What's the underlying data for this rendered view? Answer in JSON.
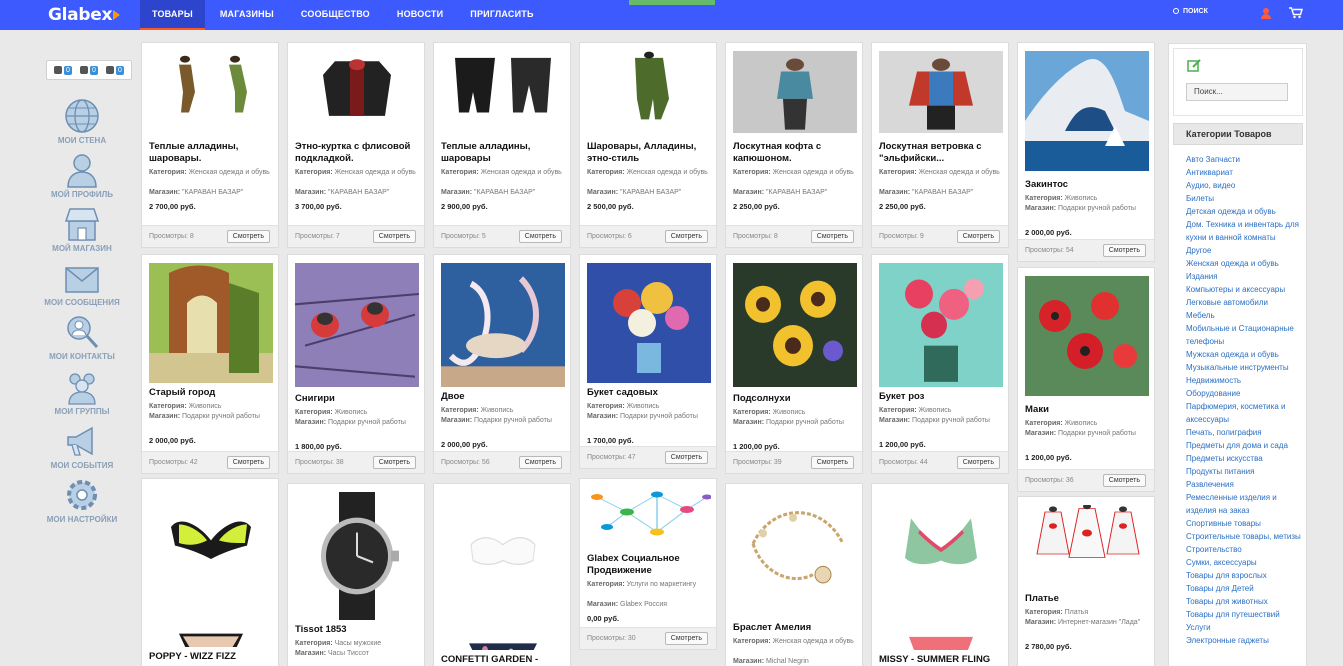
{
  "header": {
    "logo": "Glabex",
    "nav": [
      "ТОВАРЫ",
      "МАГАЗИНЫ",
      "СООБЩЕСТВО",
      "НОВОСТИ",
      "ПРИГЛАСИТЬ"
    ],
    "active_index": 0,
    "search": "ПОИСК"
  },
  "counters": [
    "0",
    "0",
    "0"
  ],
  "sidebar": [
    {
      "label": "МОИ СТЕНА",
      "icon": "globe-icon"
    },
    {
      "label": "МОЙ ПРОФИЛЬ",
      "icon": "profile-icon"
    },
    {
      "label": "МОЙ МАГАЗИН",
      "icon": "store-icon"
    },
    {
      "label": "МОИ СООБЩЕНИЯ",
      "icon": "envelope-icon"
    },
    {
      "label": "МОИ КОНТАКТЫ",
      "icon": "contacts-icon"
    },
    {
      "label": "МОИ ГРУППЫ",
      "icon": "groups-icon"
    },
    {
      "label": "МОИ СОБЫТИЯ",
      "icon": "megaphone-icon"
    },
    {
      "label": "МОИ НАСТРОЙКИ",
      "icon": "settings-icon"
    }
  ],
  "cards": [
    {
      "title": "Теплые алладины, шаровары.",
      "category": "Женская одежда и обувь",
      "shop": "\"КАРАВАН БАЗАР\"",
      "price": "2 700,00 руб.",
      "views": "8"
    },
    {
      "title": "Этно-куртка с флисовой подкладкой.",
      "category": "Женская одежда и обувь",
      "shop": "\"КАРАВАН БАЗАР\"",
      "price": "3 700,00 руб.",
      "views": "7"
    },
    {
      "title": "Теплые алладины, шаровары",
      "category": "Женская одежда и обувь",
      "shop": "\"КАРАВАН БАЗАР\"",
      "price": "2 900,00 руб.",
      "views": "5"
    },
    {
      "title": "Шаровары, Алладины, этно-стиль",
      "category": "Женская одежда и обувь",
      "shop": "\"КАРАВАН БАЗАР\"",
      "price": "2 500,00 руб.",
      "views": "6"
    },
    {
      "title": "Лоскутная кофта с капюшоном.",
      "category": "Женская одежда и обувь",
      "shop": "\"КАРАВАН БАЗАР\"",
      "price": "2 250,00 руб.",
      "views": "8"
    },
    {
      "title": "Лоскутная ветровка с \"эльфийски...",
      "category": "Женская одежда и обувь",
      "shop": "\"КАРАВАН БАЗАР\"",
      "price": "2 250,00 руб.",
      "views": "9"
    },
    {
      "title": "Закинтос",
      "category": "Живопись",
      "shop": "Подарки ручной работы",
      "price": "2 000,00 руб.",
      "views": "54"
    },
    {
      "title": "Старый город",
      "category": "Живопись",
      "shop": "Подарки ручной работы",
      "price": "2 000,00 руб.",
      "views": "42"
    },
    {
      "title": "Снигири",
      "category": "Живопись",
      "shop": "Подарки ручной работы",
      "price": "1 800,00 руб.",
      "views": "38"
    },
    {
      "title": "Двое",
      "category": "Живопись",
      "shop": "Подарки ручной работы",
      "price": "2 000,00 руб.",
      "views": "56"
    },
    {
      "title": "Букет садовых",
      "category": "Живопись",
      "shop": "Подарки ручной работы",
      "price": "1 700,00 руб.",
      "views": "47"
    },
    {
      "title": "Подсолнухи",
      "category": "Живопись",
      "shop": "Подарки ручной работы",
      "price": "1 200,00 руб.",
      "views": "39"
    },
    {
      "title": "Букет роз",
      "category": "Живопись",
      "shop": "Подарки ручной работы",
      "price": "1 200,00 руб.",
      "views": "44"
    },
    {
      "title": "Маки",
      "category": "Живопись",
      "shop": "Подарки ручной работы",
      "price": "1 200,00 руб.",
      "views": "36"
    },
    {
      "title": "POPPY - WIZZ FIZZ",
      "category": "",
      "shop": "",
      "price": "",
      "views": ""
    },
    {
      "title": "Tissot 1853",
      "category": "Часы мужские",
      "shop": "Часы Тиссот",
      "price": "",
      "views": ""
    },
    {
      "title": "CONFETTI GARDEN -",
      "category": "",
      "shop": "",
      "price": "",
      "views": ""
    },
    {
      "title": "Glabex Социальное Продвижение",
      "category": "Услуги по маркетингу",
      "shop": "Glabex Россия",
      "price": "0,00 руб.",
      "views": "30"
    },
    {
      "title": "Браслет Амелия",
      "category": "Женская одежда и обувь",
      "shop": "Michal Negrin",
      "price": "",
      "views": ""
    },
    {
      "title": "MISSY - SUMMER FLING",
      "category": "",
      "shop": "",
      "price": "",
      "views": ""
    },
    {
      "title": "Платье",
      "category": "Платья",
      "shop": "Интернет-магазин \"Лада\"",
      "price": "2 780,00 руб.",
      "views": ""
    }
  ],
  "labels": {
    "category": "Категория:",
    "shop": "Магазин:",
    "views": "Просмотры:",
    "view_btn": "Смотреть"
  },
  "right": {
    "search_placeholder": "Поиск...",
    "categories_title": "Категории Товаров",
    "categories": [
      "Авто Запчасти",
      "Антиквариат",
      "Аудио, видео",
      "Билеты",
      "Детская одежда и обувь",
      "Дом. Техника и инвентарь для кухни и ванной комнаты",
      "Другое",
      "Женская одежда и обувь",
      "Издания",
      "Компьютеры и аксессуары",
      "Легковые автомобили",
      "Мебель",
      "Мобильные и Стационарные телефоны",
      "Мужская одежда и обувь",
      "Музыкальные инструменты",
      "Недвижимость",
      "Оборудование",
      "Парфюмерия, косметика и аксессуары",
      "Печать, полиграфия",
      "Предметы для дома и сада",
      "Предметы искусства",
      "Продукты питания",
      "Развлечения",
      "Ремесленные изделия и изделия на заказ",
      "Спортивные товары",
      "Строительные товары, метизы",
      "Строительство",
      "Сумки, аксессуары",
      "Товары для взрослых",
      "Товары для Детей",
      "Товары для животных",
      "Товары для путешествий",
      "Услуги",
      "Электронные гаджеты"
    ]
  },
  "colors": {
    "topbar": "#3d5afe",
    "link": "#2a6fc4",
    "accent": "#ff5722"
  }
}
